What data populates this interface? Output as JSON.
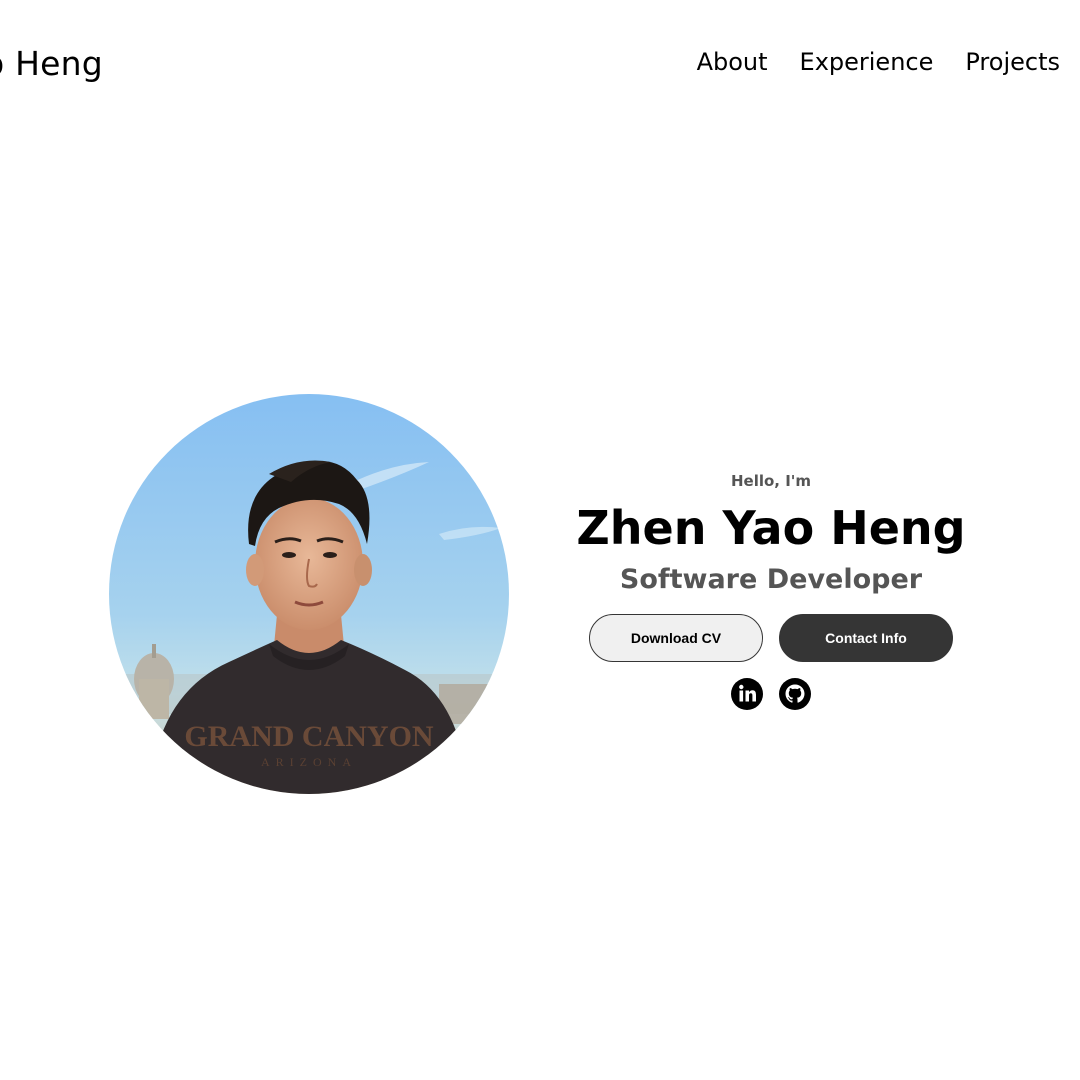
{
  "header": {
    "logo_text": "o Heng"
  },
  "nav": {
    "items": [
      {
        "label": "About"
      },
      {
        "label": "Experience"
      },
      {
        "label": "Projects"
      }
    ]
  },
  "profile": {
    "greeting": "Hello, I'm",
    "name": "Zhen Yao Heng",
    "role": "Software Developer",
    "photo_alt": "profile photo",
    "buttons": {
      "download_cv": "Download CV",
      "contact_info": "Contact Info"
    },
    "socials": [
      {
        "icon": "linkedin-icon"
      },
      {
        "icon": "github-icon"
      }
    ]
  },
  "colors": {
    "text": "#000000",
    "muted": "#555555",
    "button_dark": "#353535",
    "button_light": "#f0f0f0",
    "sky": "#8fc4ef"
  }
}
